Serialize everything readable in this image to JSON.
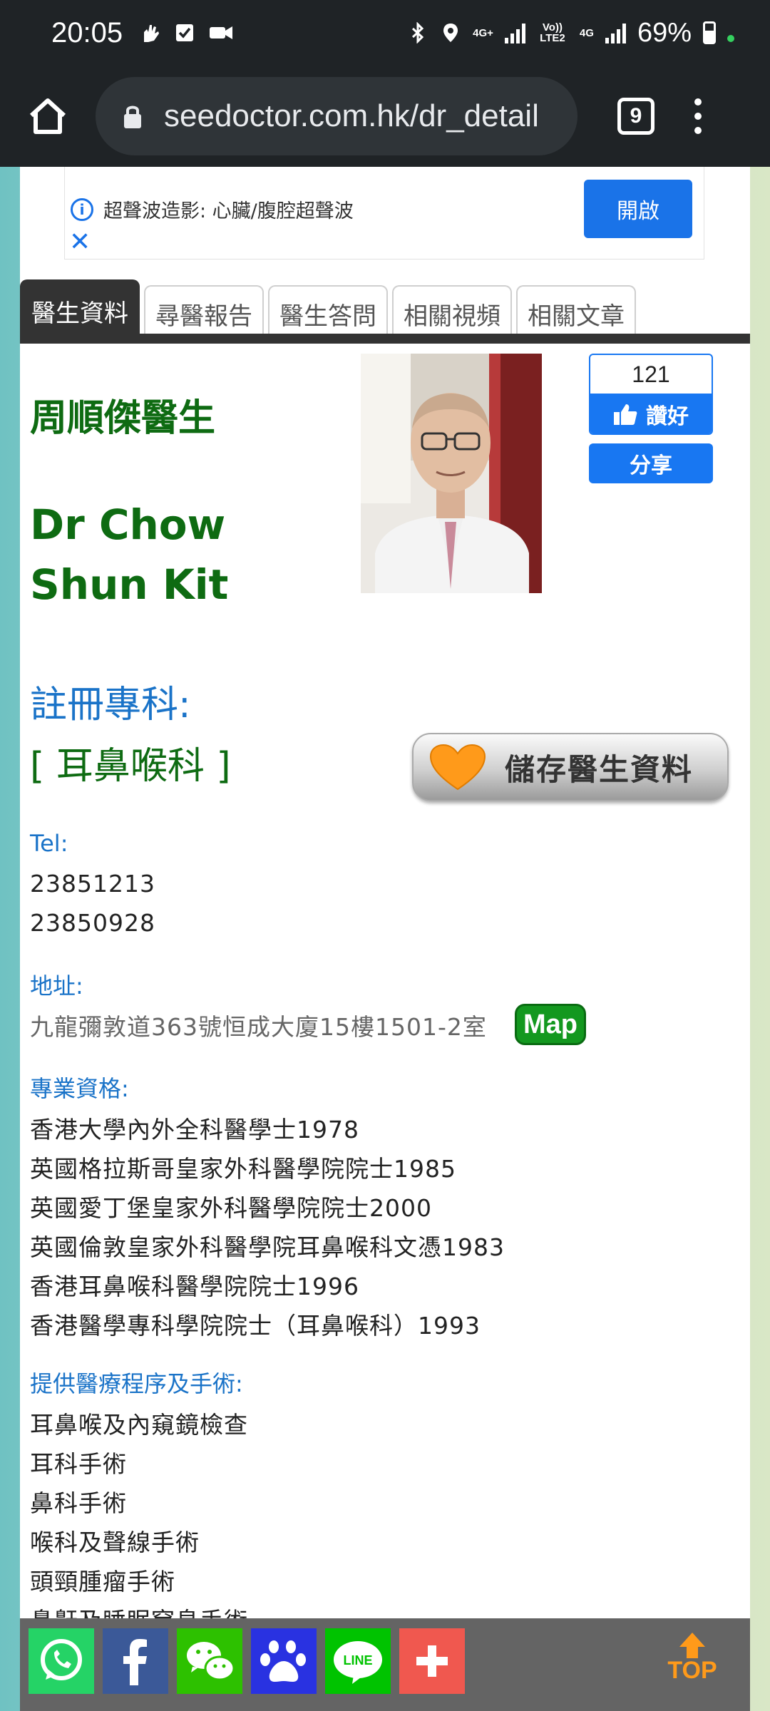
{
  "status_bar": {
    "time": "20:05",
    "network_4g_plus": "4G+",
    "volte": "Vo)) LTE2",
    "network_4g": "4G",
    "battery": "69%"
  },
  "browser": {
    "url": "seedoctor.com.hk/dr_detail",
    "tab_count": "9"
  },
  "ad": {
    "text": "超聲波造影: 心臟/腹腔超聲波",
    "open_label": "開啟",
    "info_symbol": "i",
    "close_symbol": "✕"
  },
  "tabs": [
    {
      "label": "醫生資料",
      "active": true
    },
    {
      "label": "尋醫報告",
      "active": false
    },
    {
      "label": "醫生答問",
      "active": false
    },
    {
      "label": "相關視頻",
      "active": false
    },
    {
      "label": "相關文章",
      "active": false
    }
  ],
  "doctor": {
    "name_zh": "周順傑醫生",
    "name_en": "Dr Chow Shun Kit",
    "specialty_label": "註冊專科:",
    "specialty": "[ 耳鼻喉科 ]"
  },
  "facebook": {
    "like_count": "121",
    "like_label": "讚好",
    "share_label": "分享"
  },
  "save_button": {
    "label": "儲存醫生資料"
  },
  "contact": {
    "tel_label": "Tel:",
    "tel_numbers": [
      "23851213",
      "23850928"
    ],
    "address_label": "地址:",
    "address": "九龍彌敦道363號恒成大廈15樓1501-2室",
    "map_label": "Map"
  },
  "qualifications": {
    "label": "專業資格:",
    "items": [
      "香港大學內外全科醫學士1978",
      "英國格拉斯哥皇家外科醫學院院士1985",
      "英國愛丁堡皇家外科醫學院院士2000",
      "英國倫敦皇家外科醫學院耳鼻喉科文憑1983",
      "香港耳鼻喉科醫學院院士1996",
      "香港醫學專科學院院士（耳鼻喉科）1993"
    ]
  },
  "procedures": {
    "label": "提供醫療程序及手術:",
    "items": [
      "耳鼻喉及內窺鏡檢查",
      "耳科手術",
      "鼻科手術",
      "喉科及聲線手術",
      "頭頸腫瘤手術",
      "鼻鼾及睡眠窒息手術"
    ]
  },
  "share_bar": {
    "top_label": "TOP",
    "line_label": "LINE",
    "buttons": [
      {
        "name": "whatsapp-icon",
        "color": "#25d366"
      },
      {
        "name": "facebook-icon",
        "color": "#3b5998"
      },
      {
        "name": "wechat-icon",
        "color": "#2dc100"
      },
      {
        "name": "baidu-paw-icon",
        "color": "#2932e1"
      },
      {
        "name": "line-icon",
        "color": "#00c300"
      },
      {
        "name": "more-share-icon",
        "color": "#f0584f"
      }
    ]
  }
}
